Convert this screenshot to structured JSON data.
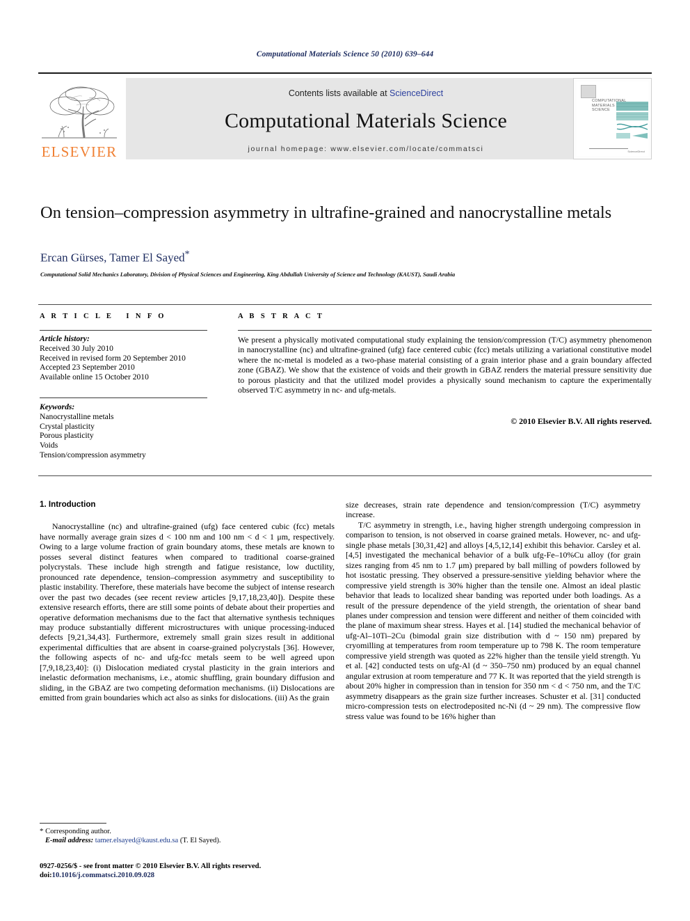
{
  "running_head": "Computational Materials Science 50 (2010) 639–644",
  "masthead": {
    "publisher_wordmark": "ELSEVIER",
    "publisher_logo_icon": "elsevier-tree-icon",
    "contents_prefix": "Contents lists available at ",
    "contents_link": "ScienceDirect",
    "journal_title": "Computational Materials Science",
    "homepage": "journal homepage: www.elsevier.com/locate/commatsci",
    "cover": {
      "title_lines": "COMPUTATIONAL MATERIALS SCIENCE",
      "footer_mark": "ScienceDirect",
      "accent_color": "#3f9b9b"
    }
  },
  "article": {
    "title": "On tension–compression asymmetry in ultrafine-grained and nanocrystalline metals",
    "authors": "Ercan Gürses, Tamer El Sayed",
    "corresponding_marker": "*",
    "affiliation": "Computational Solid Mechanics Laboratory, Division of Physical Sciences and Engineering, King Abdullah University of Science and Technology (KAUST), Saudi Arabia"
  },
  "article_info": {
    "heading": "ARTICLE INFO",
    "history_label": "Article history:",
    "history": [
      "Received 30 July 2010",
      "Received in revised form 20 September 2010",
      "Accepted 23 September 2010",
      "Available online 15 October 2010"
    ],
    "keywords_label": "Keywords:",
    "keywords": [
      "Nanocrystalline metals",
      "Crystal plasticity",
      "Porous plasticity",
      "Voids",
      "Tension/compression asymmetry"
    ]
  },
  "abstract": {
    "heading": "ABSTRACT",
    "text": "We present a physically motivated computational study explaining the tension/compression (T/C) asymmetry phenomenon in nanocrystalline (nc) and ultrafine-grained (ufg) face centered cubic (fcc) metals utilizing a variational constitutive model where the nc-metal is modeled as a two-phase material consisting of a grain interior phase and a grain boundary affected zone (GBAZ). We show that the existence of voids and their growth in GBAZ renders the material pressure sensitivity due to porous plasticity and that the utilized model provides a physically sound mechanism to capture the experimentally observed T/C asymmetry in nc- and ufg-metals.",
    "copyright": "© 2010 Elsevier B.V. All rights reserved."
  },
  "body": {
    "section_heading": "1. Introduction",
    "left_paragraph_1": "Nanocrystalline (nc) and ultrafine-grained (ufg) face centered cubic (fcc) metals have normally average grain sizes d < 100 nm and 100 nm < d < 1 μm, respectively. Owing to a large volume fraction of grain boundary atoms, these metals are known to posses several distinct features when compared to traditional coarse-grained polycrystals. These include high strength and fatigue resistance, low ductility, pronounced rate dependence, tension–compression asymmetry and susceptibility to plastic instability. Therefore, these materials have become the subject of intense research over the past two decades (see recent review articles [9,17,18,23,40]). Despite these extensive research efforts, there are still some points of debate about their properties and operative deformation mechanisms due to the fact that alternative synthesis techniques may produce substantially different microstructures with unique processing-induced defects [9,21,34,43]. Furthermore, extremely small grain sizes result in additional experimental difficulties that are absent in coarse-grained polycrystals [36]. However, the following aspects of nc- and ufg-fcc metals seem to be well agreed upon [7,9,18,23,40]: (i) Dislocation mediated crystal plasticity in the grain interiors and inelastic deformation mechanisms, i.e., atomic shuffling, grain boundary diffusion and sliding, in the GBAZ are two competing deformation mechanisms. (ii) Dislocations are emitted from grain boundaries which act also as sinks for dislocations. (iii) As the grain",
    "right_paragraph_1": "size decreases, strain rate dependence and tension/compression (T/C) asymmetry increase.",
    "right_paragraph_2": "T/C asymmetry in strength, i.e., having higher strength undergoing compression in comparison to tension, is not observed in coarse grained metals. However, nc- and ufg-single phase metals [30,31,42] and alloys [4,5,12,14] exhibit this behavior. Carsley et al. [4,5] investigated the mechanical behavior of a bulk ufg-Fe–10%Cu alloy (for grain sizes ranging from 45 nm to 1.7 μm) prepared by ball milling of powders followed by hot isostatic pressing. They observed a pressure-sensitive yielding behavior where the compressive yield strength is 30% higher than the tensile one. Almost an ideal plastic behavior that leads to localized shear banding was reported under both loadings. As a result of the pressure dependence of the yield strength, the orientation of shear band planes under compression and tension were different and neither of them coincided with the plane of maximum shear stress. Hayes et al. [14] studied the mechanical behavior of ufg-Al–10Ti–2Cu (bimodal grain size distribution with d ~ 150 nm) prepared by cryomilling at temperatures from room temperature up to 798 K. The room temperature compressive yield strength was quoted as 22% higher than the tensile yield strength. Yu et al. [42] conducted tests on ufg-Al (d ~ 350–750 nm) produced by an equal channel angular extrusion at room temperature and 77 K. It was reported that the yield strength is about 20% higher in compression than in tension for 350 nm < d < 750 nm, and the T/C asymmetry disappears as the grain size further increases. Schuster et al. [31] conducted micro-compression tests on electrodeposited nc-Ni (d ~ 29 nm). The compressive flow stress value was found to be 16% higher than"
  },
  "footnote": {
    "star": "*",
    "corresponding": "Corresponding author.",
    "email_label": "E-mail address:",
    "email": "tamer.elsayed@kaust.edu.sa",
    "email_suffix": "(T. El Sayed)."
  },
  "footer": {
    "issn_line": "0927-0256/$ - see front matter © 2010 Elsevier B.V. All rights reserved.",
    "doi_label": "doi:",
    "doi": "10.1016/j.commatsci.2010.09.028"
  }
}
